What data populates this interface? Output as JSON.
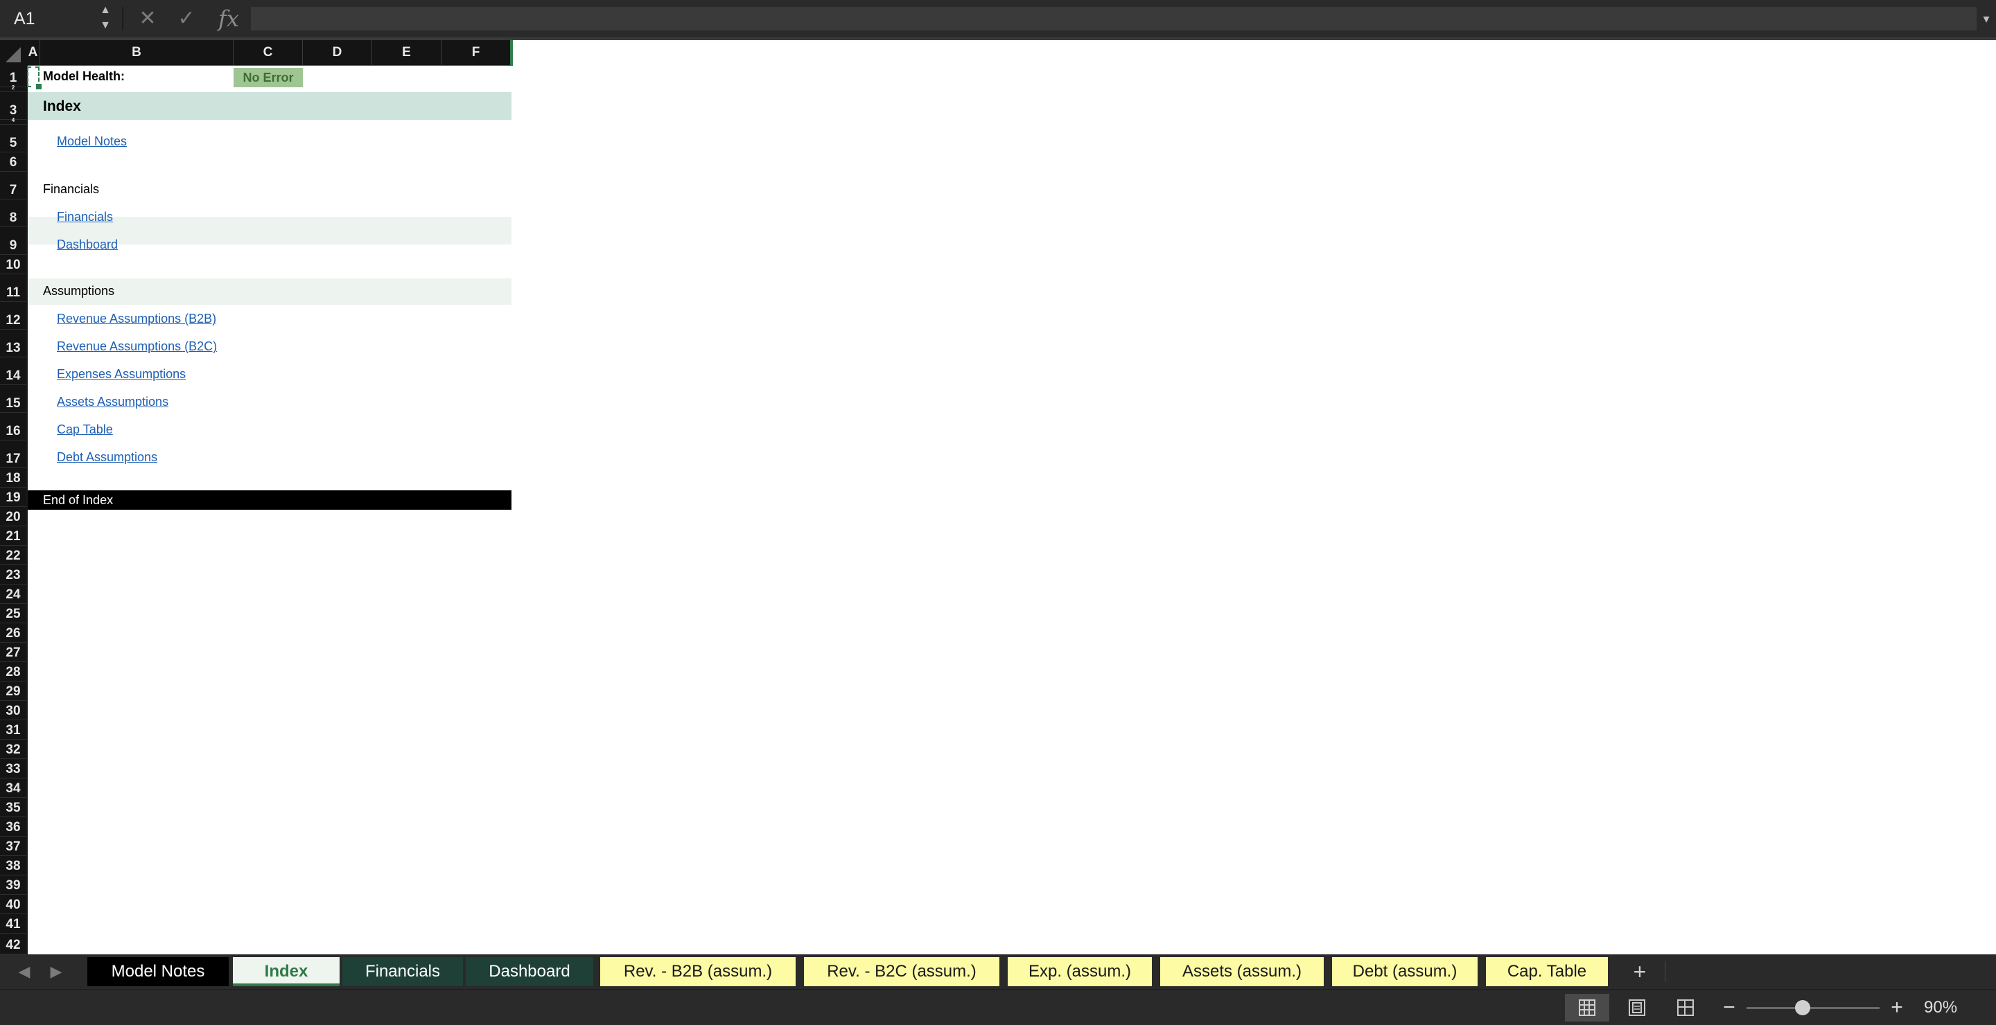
{
  "formula_bar": {
    "name_box": "A1",
    "name_box_arrows": "▲\n▼",
    "cancel_icon": "✕",
    "enter_icon": "✓",
    "fx_label": "fx",
    "formula_value": "",
    "expand_icon": "▾"
  },
  "columns": [
    "A",
    "B",
    "C",
    "D",
    "E",
    "F"
  ],
  "rows": [
    "1",
    "2",
    "3",
    "4",
    "5",
    "6",
    "7",
    "8",
    "9",
    "10",
    "11",
    "12",
    "13",
    "14",
    "15",
    "16",
    "17",
    "18",
    "19",
    "20",
    "21",
    "22",
    "23",
    "24",
    "25",
    "26",
    "27",
    "28",
    "29",
    "30",
    "31",
    "32",
    "33",
    "34",
    "35",
    "36",
    "37",
    "38",
    "39",
    "40",
    "41",
    "42"
  ],
  "sheet": {
    "model_health_label": "Model Health:",
    "model_health_status": "No Error",
    "index_title": "Index",
    "model_notes_link": "Model Notes",
    "financials_section": "Financials",
    "financials_link": "Financials",
    "dashboard_link": "Dashboard",
    "assumptions_section": "Assumptions",
    "rev_b2b_link": "Revenue Assumptions (B2B)",
    "rev_b2c_link": "Revenue Assumptions (B2C)",
    "expenses_link": "Expenses Assumptions",
    "assets_link": "Assets Assumptions",
    "cap_table_link": "Cap Table",
    "debt_link": "Debt Assumptions",
    "end_of_index": "End of Index"
  },
  "tabs": {
    "prev_arrow": "◀",
    "next_arrow": "▶",
    "items": [
      "Model Notes",
      "Index",
      "Financials",
      "Dashboard",
      "Rev. - B2B (assum.)",
      "Rev. - B2C (assum.)",
      "Exp. (assum.)",
      "Assets (assum.)",
      "Debt (assum.)",
      "Cap. Table"
    ],
    "active": "Index",
    "add_icon": "+"
  },
  "status_bar": {
    "zoom_out_icon": "−",
    "zoom_in_icon": "+",
    "zoom_level": "90%",
    "zoom_fraction": 0.42
  },
  "colors": {
    "index_band": "#cde3dc",
    "section_band": "#edf3ef",
    "end_band": "#000000",
    "status_badge": "#9fc593",
    "tab_dark": "#000000",
    "tab_green": "#1e4036",
    "tab_yellow": "#fdfba4",
    "link": "#1e5fb4"
  }
}
